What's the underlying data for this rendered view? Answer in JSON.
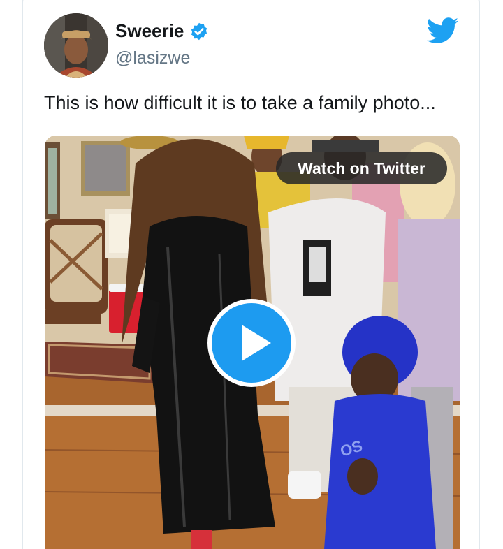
{
  "tweet": {
    "display_name": "Sweerie",
    "handle": "@lasizwe",
    "verified": true,
    "text": "This is how difficult it is to take a family photo..."
  },
  "media": {
    "watch_label": "Watch on Twitter",
    "type": "video"
  },
  "icons": {
    "avatar": "avatar",
    "verified": "verified-badge-icon",
    "brand": "twitter-bird-icon",
    "play": "play-icon"
  },
  "colors": {
    "brand": "#1da1f2",
    "text": "#14171a",
    "secondary": "#657786"
  }
}
